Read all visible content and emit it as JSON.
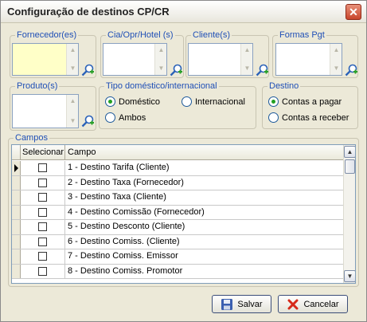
{
  "window": {
    "title": "Configuração de destinos CP/CR",
    "close_label": "✕"
  },
  "groups": {
    "fornecedor": "Fornecedor(es)",
    "cia": "Cia/Opr/Hotel (s)",
    "cliente": "Cliente(s)",
    "formas": "Formas Pgt",
    "produto": "Produto(s)",
    "tipo": "Tipo doméstico/internacional",
    "destino": "Destino",
    "campos": "Campos"
  },
  "tipo_options": {
    "domestico": "Doméstico",
    "internacional": "Internacional",
    "ambos": "Ambos",
    "selected": "Doméstico"
  },
  "destino_options": {
    "pagar": "Contas a pagar",
    "receber": "Contas a receber",
    "selected": "Contas a pagar"
  },
  "grid": {
    "columns": [
      "Selecionar",
      "Campo"
    ],
    "rows": [
      {
        "campo": "1 - Destino Tarifa (Cliente)",
        "checked": false
      },
      {
        "campo": "2 - Destino Taxa (Fornecedor)",
        "checked": false
      },
      {
        "campo": "3 - Destino Taxa (Cliente)",
        "checked": false
      },
      {
        "campo": "4 - Destino Comissão (Fornecedor)",
        "checked": false
      },
      {
        "campo": "5 - Destino Desconto (Cliente)",
        "checked": false
      },
      {
        "campo": "6 - Destino Comiss. (Cliente)",
        "checked": false
      },
      {
        "campo": "7 - Destino Comiss. Emissor",
        "checked": false
      },
      {
        "campo": "8 - Destino Comiss. Promotor",
        "checked": false
      }
    ]
  },
  "buttons": {
    "salvar": "Salvar",
    "cancelar": "Cancelar"
  },
  "icons": {
    "lookup": "lookup-icon",
    "save": "save-icon",
    "cancel": "cancel-icon"
  }
}
